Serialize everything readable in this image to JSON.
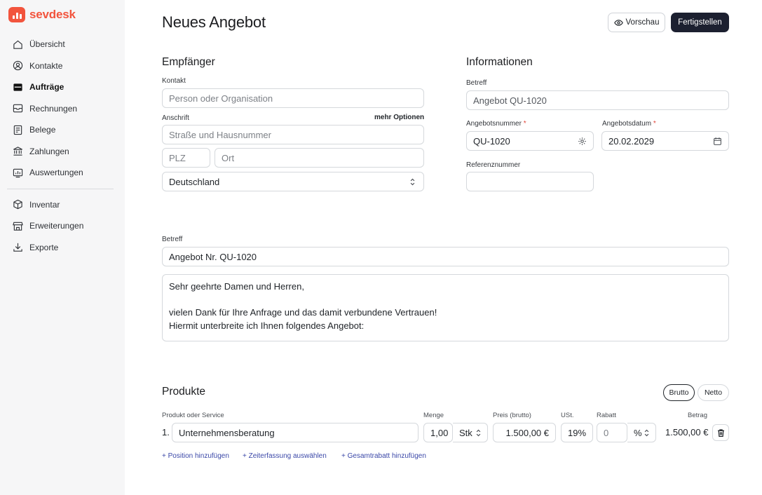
{
  "brand": {
    "name": "sevdesk",
    "color": "#f2543d"
  },
  "sidebar": {
    "items": [
      {
        "label": "Übersicht",
        "icon": "home-icon"
      },
      {
        "label": "Kontakte",
        "icon": "contacts-icon"
      },
      {
        "label": "Aufträge",
        "icon": "orders-icon",
        "active": true
      },
      {
        "label": "Rechnungen",
        "icon": "invoice-icon"
      },
      {
        "label": "Belege",
        "icon": "receipt-icon"
      },
      {
        "label": "Zahlungen",
        "icon": "bank-icon"
      },
      {
        "label": "Auswertungen",
        "icon": "chart-icon"
      }
    ],
    "items2": [
      {
        "label": "Inventar",
        "icon": "box-icon"
      },
      {
        "label": "Erweiterungen",
        "icon": "store-icon"
      },
      {
        "label": "Exporte",
        "icon": "download-icon"
      }
    ]
  },
  "header": {
    "title": "Neues Angebot",
    "preview_label": "Vorschau",
    "finish_label": "Fertigstellen"
  },
  "recipient": {
    "title": "Empfänger",
    "contact_label": "Kontakt",
    "contact_placeholder": "Person oder Organisation",
    "address_label": "Anschrift",
    "more_options": "mehr Optionen",
    "street_placeholder": "Straße und Hausnummer",
    "zip_placeholder": "PLZ",
    "city_placeholder": "Ort",
    "country": "Deutschland"
  },
  "info": {
    "title": "Informationen",
    "subject_label": "Betreff",
    "subject_value": "Angebot QU-1020",
    "number_label": "Angebotsnummer",
    "number_value": "QU-1020",
    "date_label": "Angebotsdatum",
    "date_value": "20.02.2029",
    "required_mark": "*",
    "ref_label": "Referenznummer",
    "ref_value": ""
  },
  "letter": {
    "subject_label": "Betreff",
    "subject_value": "Angebot Nr. QU-1020",
    "text_line1": "Sehr geehrte Damen und Herren,",
    "text_line2": "vielen Dank für Ihre Anfrage und das damit verbundene Vertrauen!",
    "text_line3": "Hiermit unterbreite ich Ihnen folgendes Angebot:"
  },
  "products": {
    "title": "Produkte",
    "toggle_gross": "Brutto",
    "toggle_net": "Netto",
    "col_product": "Produkt oder Service",
    "col_qty": "Menge",
    "col_price": "Preis (brutto)",
    "col_tax": "USt.",
    "col_discount": "Rabatt",
    "col_amount": "Betrag",
    "row": {
      "index": "1.",
      "name": "Unternehmensberatung",
      "qty": "1,00",
      "unit": "Stk",
      "price": "1.500,00 €",
      "tax": "19%",
      "discount": "0",
      "discount_unit": "%",
      "amount": "1.500,00 €"
    },
    "add_position": "+ Position hinzufügen",
    "add_time": "+ Zeiterfassung auswählen",
    "add_discount": "+ Gesamtrabatt hinzufügen"
  }
}
